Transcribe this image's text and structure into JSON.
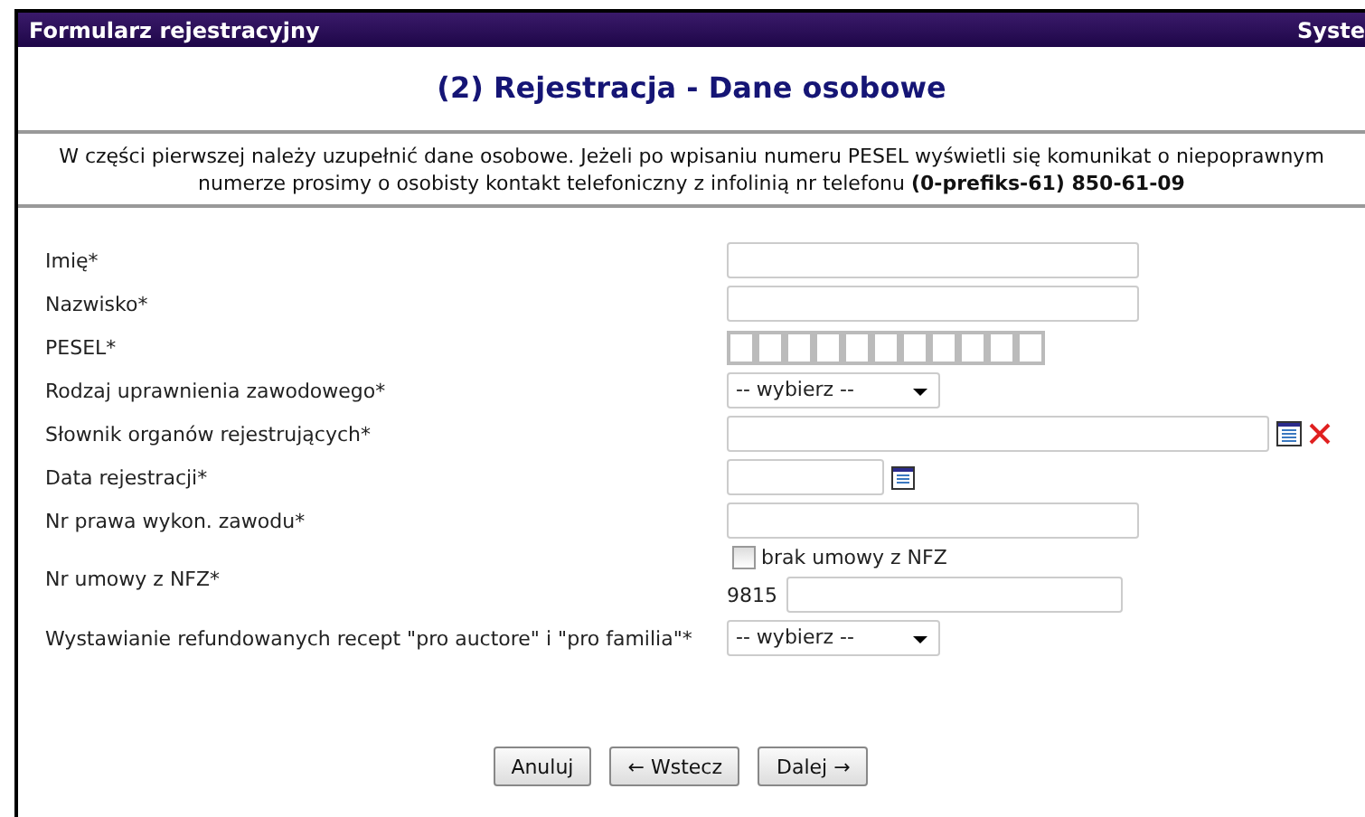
{
  "window": {
    "title": "Formularz rejestracyjny",
    "title_right": "Syste"
  },
  "heading": "(2) Rejestracja - Dane osobowe",
  "description": "W części pierwszej należy uzupełnić dane osobowe. Jeżeli po wpisaniu numeru PESEL wyświetli się komunikat o niepoprawnym numerze prosimy o osobisty kontakt telefoniczny z infolinią nr telefonu **(0-prefiks-61) 850-61-09**",
  "fields": [
    {
      "label": "Imię*",
      "kind": "text"
    },
    {
      "label": "Nazwisko*",
      "kind": "text"
    },
    {
      "label": "PESEL*",
      "kind": "pesel"
    },
    {
      "label": "Rodzaj uprawnienia zawodowego*",
      "kind": "select",
      "value": "-- wybierz --"
    },
    {
      "label": "Słownik organów rejestrujących*",
      "kind": "dictionary"
    },
    {
      "label": "Data rejestracji*",
      "kind": "date"
    },
    {
      "label": "Nr prawa wykon. zawodu*",
      "kind": "text"
    },
    {
      "label": "Nr umowy z NFZ*",
      "kind": "nfz",
      "checkbox_label": "brak umowy z NFZ",
      "checked": false,
      "prefix": "9815"
    },
    {
      "label": "Wystawianie refundowanych recept \"pro auctore\" i \"pro familia\"*",
      "kind": "select",
      "value": "-- wybierz --"
    }
  ],
  "buttons": [
    "Anuluj",
    "← Wstecz",
    "Dalej →"
  ]
}
